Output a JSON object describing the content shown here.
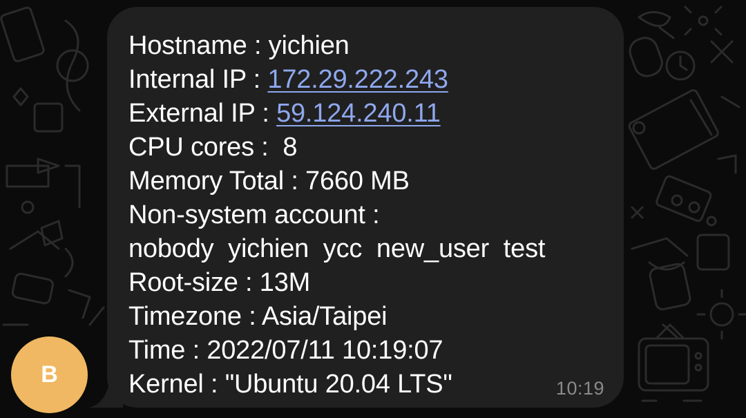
{
  "message": {
    "hostname_label": "Hostname : ",
    "hostname_value": "yichien",
    "internal_ip_label": "Internal IP : ",
    "internal_ip_value": "172.29.222.243",
    "external_ip_label": "External IP : ",
    "external_ip_value": "59.124.240.11",
    "cpu_label": "CPU cores : ",
    "cpu_value": " 8",
    "memory_label": "Memory Total : ",
    "memory_value": "7660 MB",
    "accounts_label": "Non-system account :",
    "accounts_value": "nobody  yichien  ycc  new_user  test",
    "root_size_label": "Root-size : ",
    "root_size_value": "13M",
    "timezone_label": "Timezone : ",
    "timezone_value": "Asia/Taipei",
    "time_label": "Time : ",
    "time_value": "2022/07/11 10:19:07",
    "kernel_label": "Kernel : ",
    "kernel_value": "\"Ubuntu 20.04 LTS\"",
    "sent_time": "10:19"
  },
  "sender": {
    "avatar_letter": "B",
    "avatar_color": "#f0b862"
  },
  "colors": {
    "background": "#0b0b0b",
    "bubble": "#202020",
    "link": "#8fa8ee",
    "text": "#ffffff",
    "timestamp": "#8a8a8a"
  }
}
